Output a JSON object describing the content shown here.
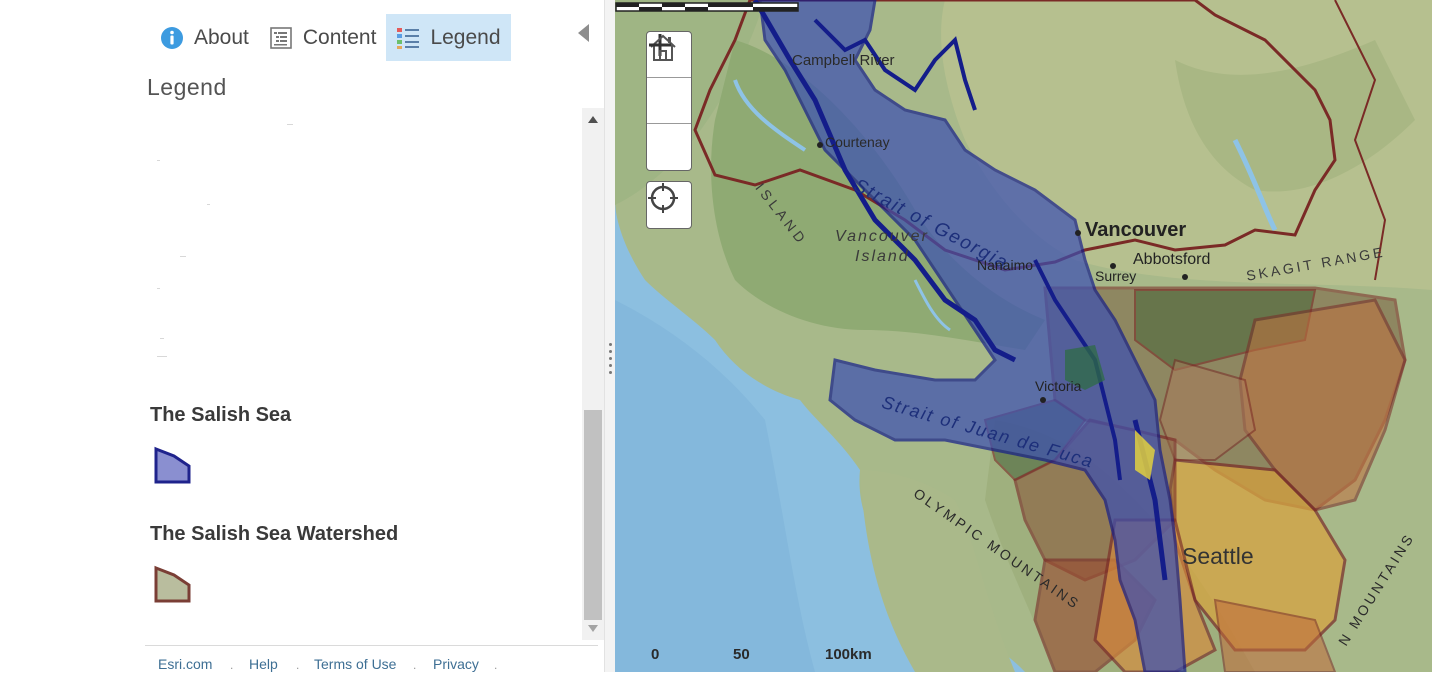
{
  "tabs": [
    {
      "label": "About",
      "icon": "info-icon",
      "active": false
    },
    {
      "label": "Content",
      "icon": "content-list-icon",
      "active": false
    },
    {
      "label": "Legend",
      "icon": "legend-list-icon",
      "active": true
    }
  ],
  "panel": {
    "title": "Legend"
  },
  "legend": {
    "layers": [
      {
        "name": "The Salish Sea",
        "fill": "#8a8fd0",
        "stroke": "#1f238c"
      },
      {
        "name": "The Salish Sea Watershed",
        "fill": "#b9bd9e",
        "stroke": "#7a3e35"
      }
    ]
  },
  "footer": {
    "links": [
      "Esri.com",
      "Help",
      "Terms of Use",
      "Privacy"
    ]
  },
  "map": {
    "labels": {
      "river": "Campbell River",
      "courtenay": "Courtenay",
      "strait_georgia": "Strait of Georgia",
      "vancouver": "Vancouver",
      "abbotsford": "Abbotsford",
      "surrey": "Surrey",
      "nanaimo": "Nanaimo",
      "vancouver_island_1": "Vancouver",
      "vancouver_island_2": "Island",
      "island_ranges": "ISLAND",
      "skagit_range": "SKAGIT RANGE",
      "victoria": "Victoria",
      "juan_de_fuca": "Strait of Juan de Fuca",
      "olympic": "OLYMPIC MOUNTAINS",
      "seattle": "Seattle",
      "cascades": "N MOUNTAINS"
    },
    "scale": {
      "ticks": [
        "0",
        "50",
        "100km"
      ]
    },
    "colors": {
      "sea_fill": "#3b4fb3",
      "sea_stroke": "#141d8a",
      "watershed_stroke": "#7a2a26"
    }
  }
}
